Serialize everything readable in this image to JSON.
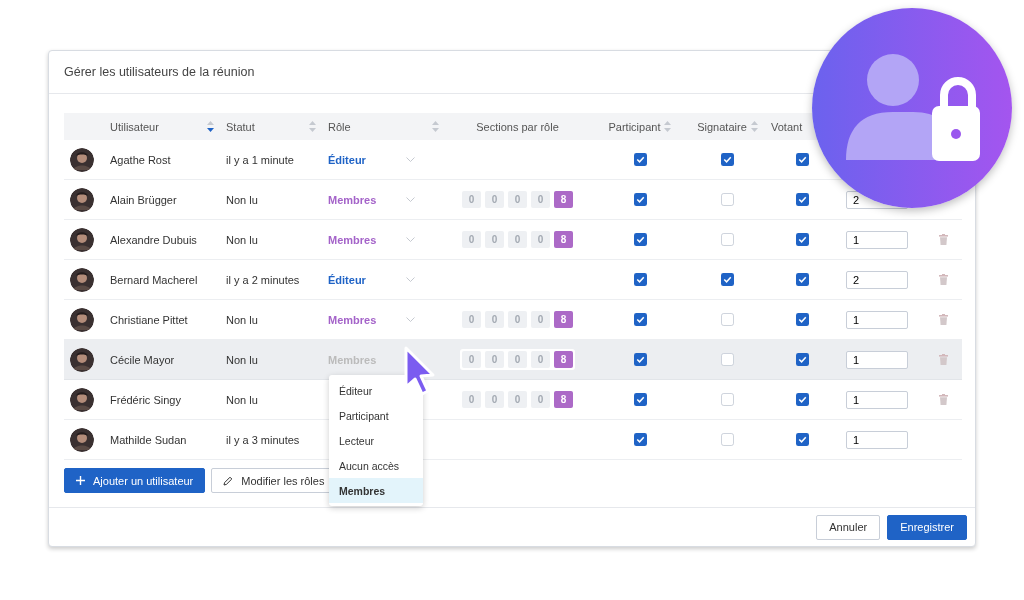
{
  "dialog": {
    "title": "Gérer les utilisateurs de la réunion"
  },
  "columns": [
    {
      "label": "Utilisateur",
      "sortable": true,
      "sorted": true
    },
    {
      "label": "Statut",
      "sortable": true,
      "sorted": false
    },
    {
      "label": "Rôle",
      "sortable": true,
      "sorted": false
    },
    {
      "label": "Sections par rôle"
    },
    {
      "label": "Participant",
      "sortable": true,
      "sorted": false
    },
    {
      "label": "Signataire",
      "sortable": true,
      "sorted": false
    },
    {
      "label": "Votant"
    }
  ],
  "rows": [
    {
      "name": "Agathe Rost",
      "status": "il y a 1 minute",
      "role": {
        "label": "Éditeur",
        "kind": "editor",
        "disabled": false
      },
      "highlighted": false,
      "participant": true,
      "signataire": true,
      "votant": true
    },
    {
      "name": "Alain Brügger",
      "status": "Non lu",
      "role": {
        "label": "Membres",
        "kind": "members",
        "disabled": false
      },
      "sections": [
        "0",
        "0",
        "0",
        "0",
        "8"
      ],
      "highlighted": false,
      "participant": true,
      "signataire": false,
      "votant": true,
      "quantity": "2"
    },
    {
      "name": "Alexandre Dubuis",
      "status": "Non lu",
      "role": {
        "label": "Membres",
        "kind": "members",
        "disabled": false
      },
      "sections": [
        "0",
        "0",
        "0",
        "0",
        "8"
      ],
      "highlighted": false,
      "participant": true,
      "signataire": false,
      "votant": true,
      "quantity": "1",
      "deletable": true
    },
    {
      "name": "Bernard Macherel",
      "status": "il y a 2 minutes",
      "role": {
        "label": "Éditeur",
        "kind": "editor",
        "disabled": false
      },
      "highlighted": false,
      "participant": true,
      "signataire": true,
      "votant": true,
      "quantity": "2",
      "deletable": true
    },
    {
      "name": "Christiane Pittet",
      "status": "Non lu",
      "role": {
        "label": "Membres",
        "kind": "members",
        "disabled": false
      },
      "sections": [
        "0",
        "0",
        "0",
        "0",
        "8"
      ],
      "highlighted": false,
      "participant": true,
      "signataire": false,
      "votant": true,
      "quantity": "1",
      "deletable": true
    },
    {
      "name": "Cécile Mayor",
      "status": "Non lu",
      "role": {
        "label": "Membres",
        "kind": "members",
        "disabled": true
      },
      "sections": [
        "0",
        "0",
        "0",
        "0",
        "8"
      ],
      "highlighted": true,
      "participant": true,
      "signataire": false,
      "votant": true,
      "quantity": "1",
      "deletable": true
    },
    {
      "name": "Frédéric Singy",
      "status": "Non lu",
      "sections": [
        "0",
        "0",
        "0",
        "0",
        "8"
      ],
      "highlighted": false,
      "participant": true,
      "signataire": false,
      "votant": true,
      "quantity": "1",
      "deletable": true
    },
    {
      "name": "Mathilde Sudan",
      "status": "il y a 3 minutes",
      "highlighted": false,
      "participant": true,
      "signataire": false,
      "votant": true,
      "quantity": "1"
    }
  ],
  "actions": [
    {
      "label": "Ajouter un utilisateur",
      "kind": "add"
    },
    {
      "label": "Modifier les rôles",
      "kind": "edit"
    }
  ],
  "role_menu": [
    {
      "label": "Éditeur",
      "selected": false
    },
    {
      "label": "Participant",
      "selected": false
    },
    {
      "label": "Lecteur",
      "selected": false
    },
    {
      "label": "Aucun accès",
      "selected": false
    },
    {
      "label": "Membres",
      "selected": true
    }
  ],
  "footer": [
    {
      "label": "Annuler",
      "kind": "secondary"
    },
    {
      "label": "Enregistrer",
      "kind": "primary"
    }
  ]
}
